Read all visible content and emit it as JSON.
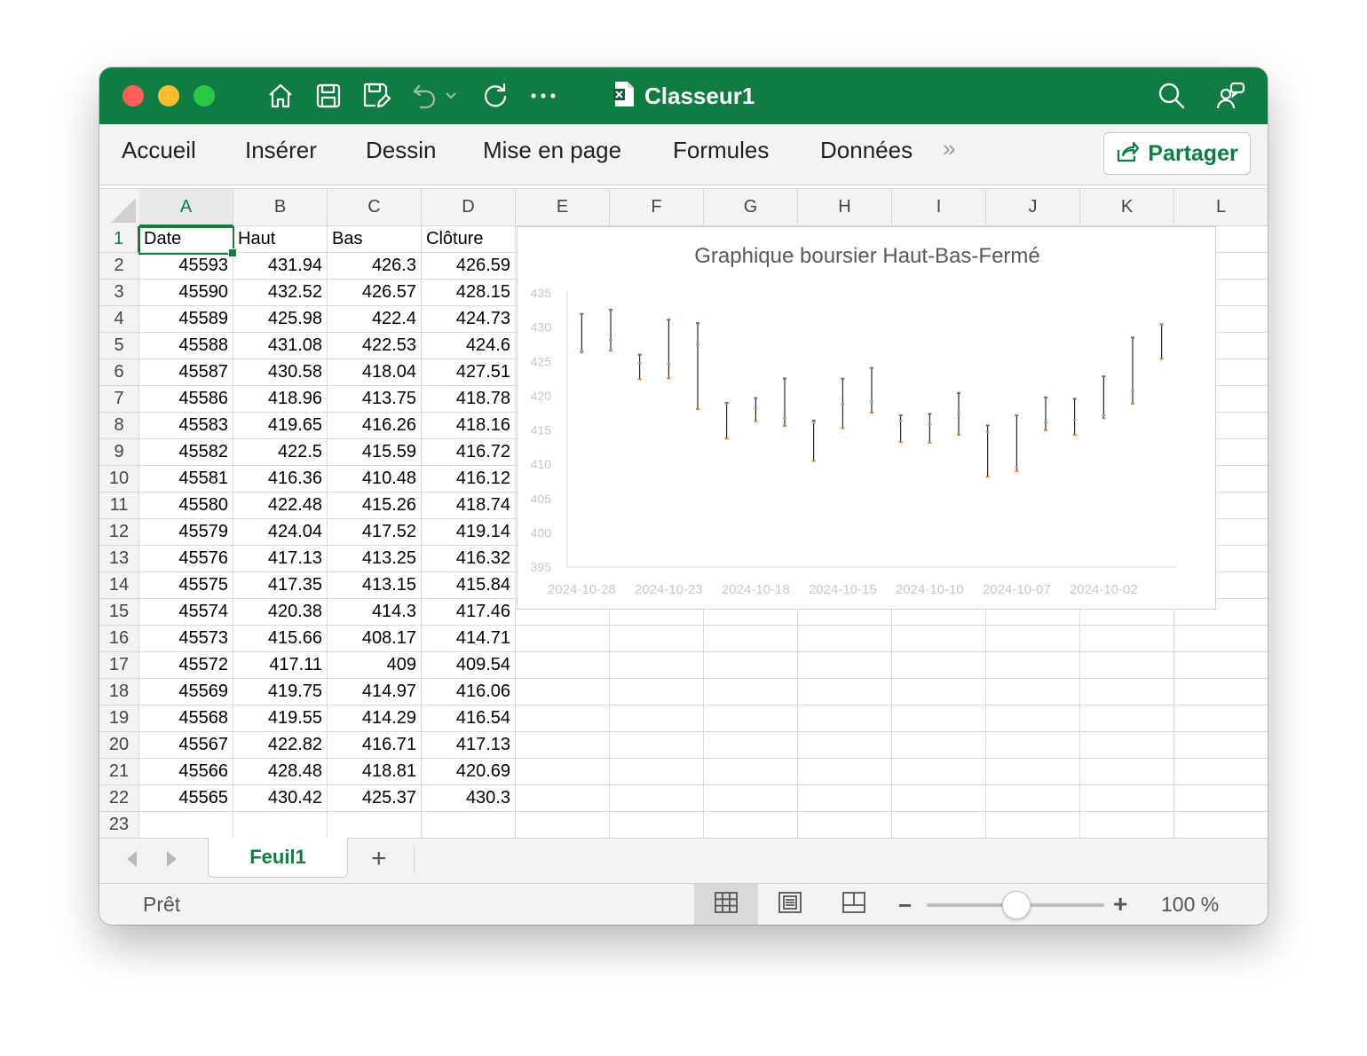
{
  "window": {
    "title": "Classeur1",
    "traffic_lights": {
      "close": "#fe5f57",
      "minimize": "#febc2e",
      "zoom": "#28c840"
    },
    "brand_color": "#107c41"
  },
  "toolbar": {
    "icons": [
      "home-icon",
      "save-icon",
      "save-as-icon",
      "undo-icon",
      "undo-dropdown-icon",
      "redo-icon",
      "more-icon"
    ],
    "right_icons": [
      "search-icon",
      "share-people-icon"
    ]
  },
  "ribbon": {
    "tabs": [
      "Accueil",
      "Insérer",
      "Dessin",
      "Mise en page",
      "Formules",
      "Données"
    ],
    "overflow": "»",
    "share_label": "Partager"
  },
  "grid": {
    "columns": [
      "A",
      "B",
      "C",
      "D",
      "E",
      "F",
      "G",
      "H",
      "I",
      "J",
      "K",
      "L"
    ],
    "row_numbers": [
      "1",
      "2",
      "3",
      "4",
      "5",
      "6",
      "7",
      "8",
      "9",
      "10",
      "11",
      "12",
      "13",
      "14",
      "15",
      "16",
      "17",
      "18",
      "19",
      "20",
      "21",
      "22",
      "23"
    ],
    "header": [
      "Date",
      "Haut",
      "Bas",
      "Clôture"
    ],
    "rows": [
      [
        "45593",
        "431.94",
        "426.3",
        "426.59"
      ],
      [
        "45590",
        "432.52",
        "426.57",
        "428.15"
      ],
      [
        "45589",
        "425.98",
        "422.4",
        "424.73"
      ],
      [
        "45588",
        "431.08",
        "422.53",
        "424.6"
      ],
      [
        "45587",
        "430.58",
        "418.04",
        "427.51"
      ],
      [
        "45586",
        "418.96",
        "413.75",
        "418.78"
      ],
      [
        "45583",
        "419.65",
        "416.26",
        "418.16"
      ],
      [
        "45582",
        "422.5",
        "415.59",
        "416.72"
      ],
      [
        "45581",
        "416.36",
        "410.48",
        "416.12"
      ],
      [
        "45580",
        "422.48",
        "415.26",
        "418.74"
      ],
      [
        "45579",
        "424.04",
        "417.52",
        "419.14"
      ],
      [
        "45576",
        "417.13",
        "413.25",
        "416.32"
      ],
      [
        "45575",
        "417.35",
        "413.15",
        "415.84"
      ],
      [
        "45574",
        "420.38",
        "414.3",
        "417.46"
      ],
      [
        "45573",
        "415.66",
        "408.17",
        "414.71"
      ],
      [
        "45572",
        "417.11",
        "409",
        "409.54"
      ],
      [
        "45569",
        "419.75",
        "414.97",
        "416.06"
      ],
      [
        "45568",
        "419.55",
        "414.29",
        "416.54"
      ],
      [
        "45567",
        "422.82",
        "416.71",
        "417.13"
      ],
      [
        "45566",
        "428.48",
        "418.81",
        "420.69"
      ],
      [
        "45565",
        "430.42",
        "425.37",
        "430.3"
      ]
    ],
    "selected_cell": "A1"
  },
  "chart_data": {
    "type": "stock-hlc",
    "title": "Graphique boursier Haut-Bas-Fermé",
    "ylim": [
      395,
      435
    ],
    "y_ticks": [
      "395",
      "400",
      "405",
      "410",
      "415",
      "420",
      "425",
      "430",
      "435"
    ],
    "x_ticks": [
      "2024-10-28",
      "2024-10-23",
      "2024-10-18",
      "2024-10-15",
      "2024-10-10",
      "2024-10-07",
      "2024-10-02"
    ],
    "high": [
      431.94,
      432.52,
      425.98,
      431.08,
      430.58,
      418.96,
      419.65,
      422.5,
      416.36,
      422.48,
      424.04,
      417.13,
      417.35,
      420.38,
      415.66,
      417.11,
      419.75,
      419.55,
      422.82,
      428.48,
      430.42
    ],
    "low": [
      426.3,
      426.57,
      422.4,
      422.53,
      418.04,
      413.75,
      416.26,
      415.59,
      410.48,
      415.26,
      417.52,
      413.25,
      413.15,
      414.3,
      408.17,
      409,
      414.97,
      414.29,
      416.71,
      418.81,
      425.37
    ],
    "close": [
      426.59,
      428.15,
      424.73,
      424.6,
      427.51,
      418.78,
      418.16,
      416.72,
      416.12,
      418.74,
      419.14,
      416.32,
      415.84,
      417.46,
      414.71,
      409.54,
      416.06,
      416.54,
      417.13,
      420.69,
      430.3
    ],
    "colors": {
      "high_marker": "#4472c4",
      "low_marker": "#ed7d31",
      "close_marker": "#a5a5a5",
      "line": "#000000",
      "axis_text": "#c8c8c8"
    }
  },
  "sheets": {
    "tabs": [
      "Feuil1"
    ],
    "add_label": "+"
  },
  "status": {
    "text": "Prêt",
    "zoom_label": "100 %",
    "zoom_level": 0.5
  }
}
